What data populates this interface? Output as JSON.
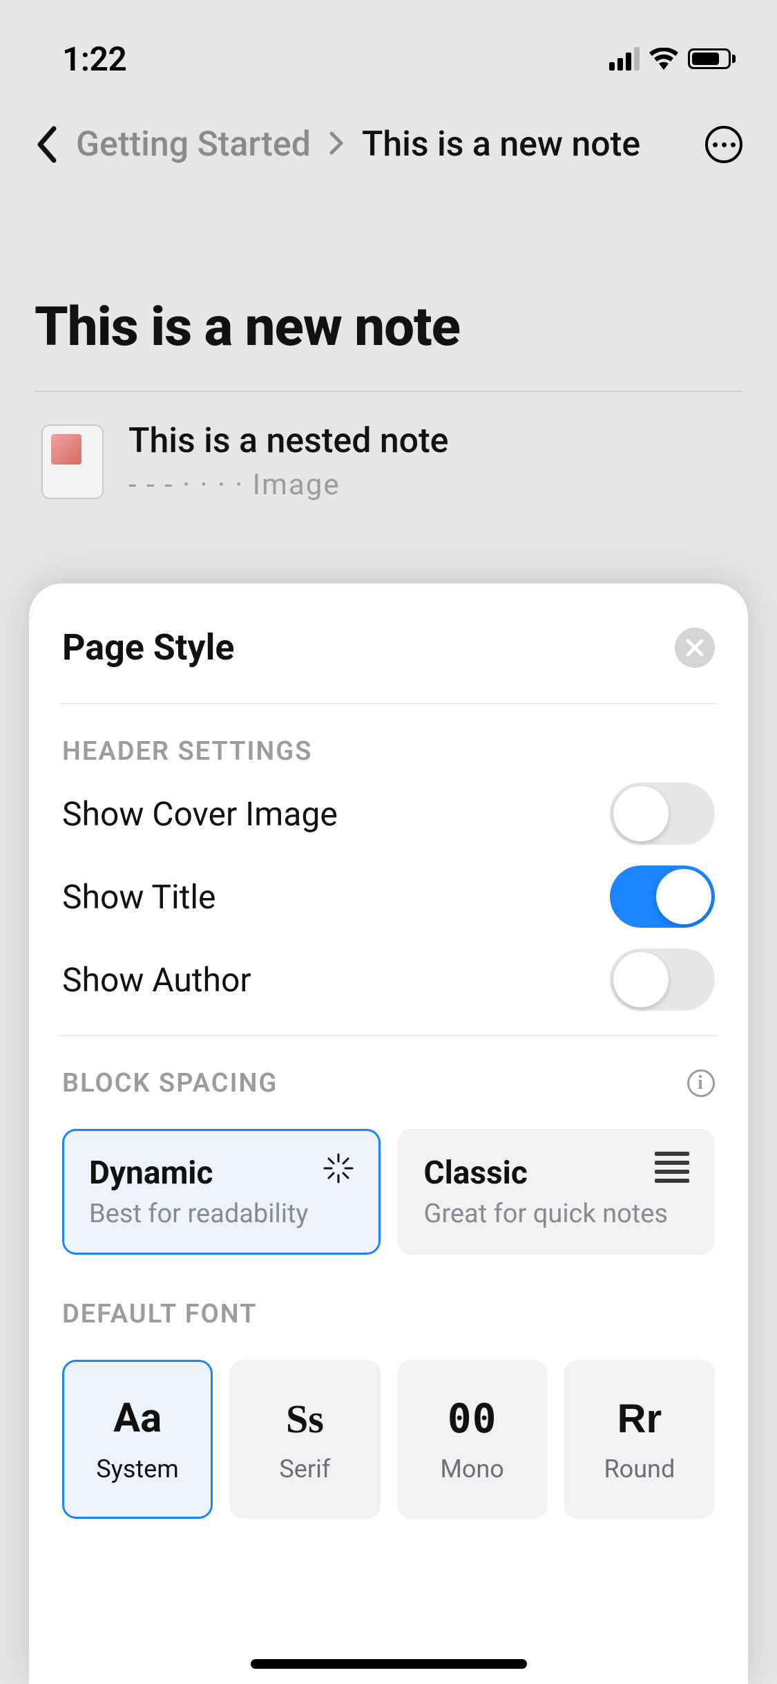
{
  "status": {
    "time": "1:22"
  },
  "breadcrumb": {
    "parent": "Getting Started",
    "current": "This is a new note"
  },
  "page": {
    "title": "This is a new note",
    "nested": {
      "title": "This is a nested note",
      "meta": "- - -  ·    ·    ·   · Image"
    }
  },
  "sheet": {
    "title": "Page Style",
    "sections": {
      "header_settings": {
        "label": "HEADER SETTINGS",
        "rows": {
          "cover": {
            "label": "Show Cover Image",
            "on": false
          },
          "title": {
            "label": "Show Title",
            "on": true
          },
          "author": {
            "label": "Show Author",
            "on": false
          }
        }
      },
      "block_spacing": {
        "label": "BLOCK SPACING",
        "options": {
          "dynamic": {
            "title": "Dynamic",
            "sub": "Best for readability",
            "selected": true
          },
          "classic": {
            "title": "Classic",
            "sub": "Great for quick notes",
            "selected": false
          }
        }
      },
      "default_font": {
        "label": "DEFAULT FONT",
        "options": {
          "system": {
            "sample": "Aa",
            "label": "System",
            "selected": true
          },
          "serif": {
            "sample": "Ss",
            "label": "Serif",
            "selected": false
          },
          "mono": {
            "sample": "00",
            "label": "Mono",
            "selected": false
          },
          "round": {
            "sample": "Rr",
            "label": "Round",
            "selected": false
          }
        }
      }
    }
  }
}
